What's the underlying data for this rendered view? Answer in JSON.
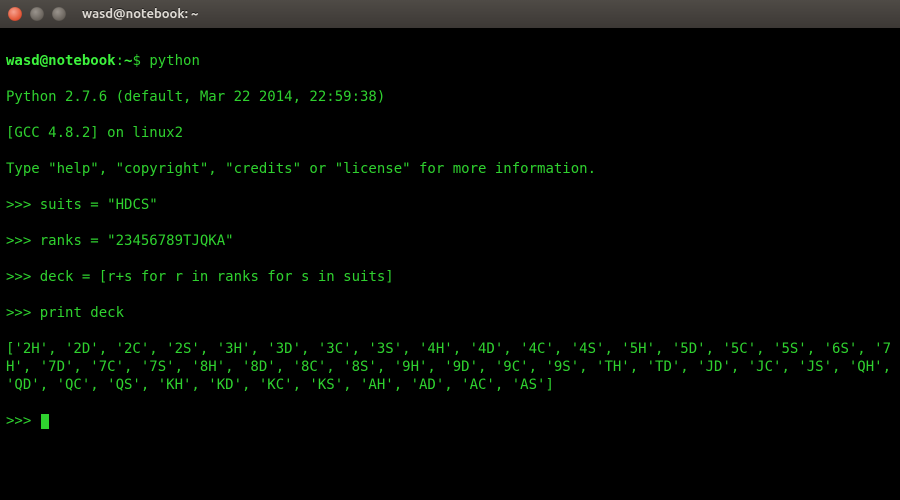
{
  "window": {
    "title": "wasd@notebook: ~"
  },
  "terminal": {
    "prompt_user_host": "wasd@notebook",
    "prompt_path": "~",
    "prompt_sep": ":",
    "prompt_end": "$",
    "repl_prompt": ">>>",
    "command": "python",
    "banner1": "Python 2.7.6 (default, Mar 22 2014, 22:59:38)",
    "banner2": "[GCC 4.8.2] on linux2",
    "banner3": "Type \"help\", \"copyright\", \"credits\" or \"license\" for more information.",
    "input1": "suits = \"HDCS\"",
    "input2": "ranks = \"23456789TJQKA\"",
    "input3": "deck = [r+s for r in ranks for s in suits]",
    "input4": "print deck",
    "output_deck": "['2H', '2D', '2C', '2S', '3H', '3D', '3C', '3S', '4H', '4D', '4C', '4S', '5H', '5D', '5C', '5S', '6S', '7H', '7D', '7C', '7S', '8H', '8D', '8C', '8S', '9H', '9D', '9C', '9S', 'TH', 'TD', 'JD', 'JC', 'JS', 'QH', 'QD', 'QC', 'QS', 'KH', 'KD', 'KC', 'KS', 'AH', 'AD', 'AC', 'AS']"
  },
  "colors": {
    "fg": "#2fd12f",
    "bg": "#000000",
    "titlebar": "#3c3835",
    "close": "#e55c3c"
  }
}
